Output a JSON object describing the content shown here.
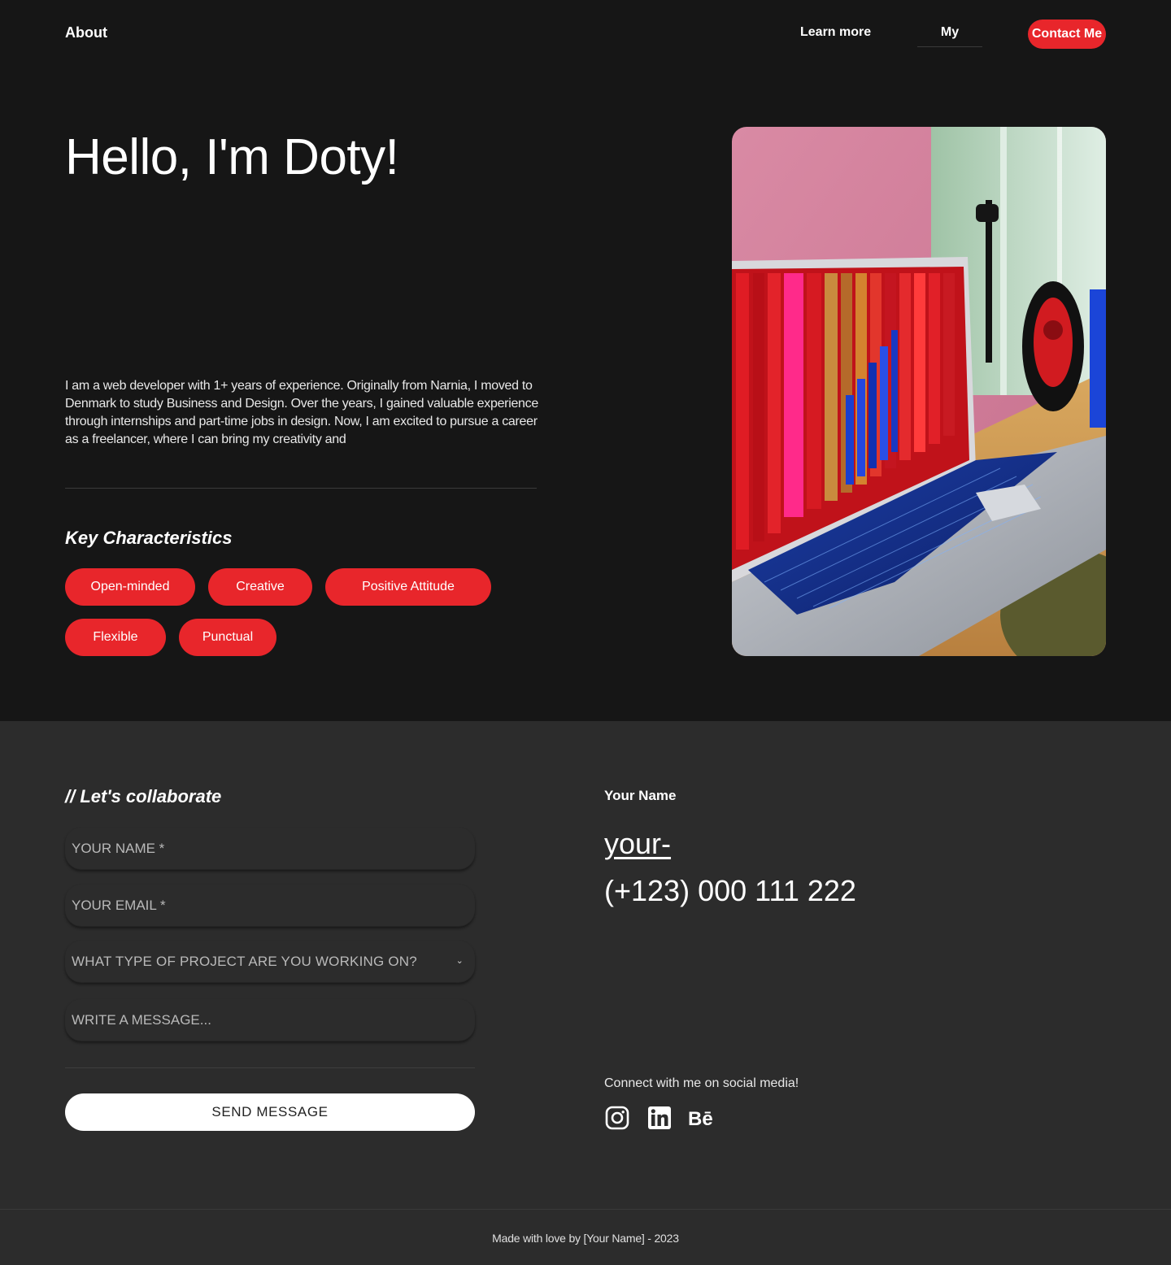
{
  "nav": {
    "brand": "About",
    "links": [
      "Learn more",
      "My"
    ],
    "cta": "Contact Me"
  },
  "hero": {
    "title": "Hello, I'm Doty!",
    "bio": "I am a web developer with 1+ years of experience. Originally from Narnia, I moved to Denmark to study Business and Design. Over the years, I gained valuable experience through internships and part-time jobs in design. Now, I am excited to pursue a career as a freelancer, where I can bring my creativity and",
    "key_title": "Key Characteristics",
    "chips": [
      "Open-minded",
      "Creative",
      "Positive Attitude",
      "Flexible",
      "Punctual"
    ]
  },
  "contact": {
    "title": "// Let's collaborate",
    "fields": {
      "name_placeholder": "YOUR NAME *",
      "email_placeholder": "YOUR EMAIL *",
      "project_value": "WHAT TYPE OF PROJECT ARE YOU WORKING ON?",
      "message_placeholder": "WRITE A MESSAGE..."
    },
    "send_label": "SEND MESSAGE",
    "info": {
      "name": "Your Name",
      "email": "your-",
      "phone": "(+123) 000 111 222",
      "social_label": "Connect with me on social media!"
    },
    "social_icons": [
      "instagram-icon",
      "linkedin-icon",
      "behance-icon"
    ]
  },
  "footer": {
    "text": "Made with love by [Your Name] - 2023"
  },
  "colors": {
    "accent": "#e8262b",
    "bg_dark": "#161616",
    "bg_section": "#2c2c2c"
  }
}
